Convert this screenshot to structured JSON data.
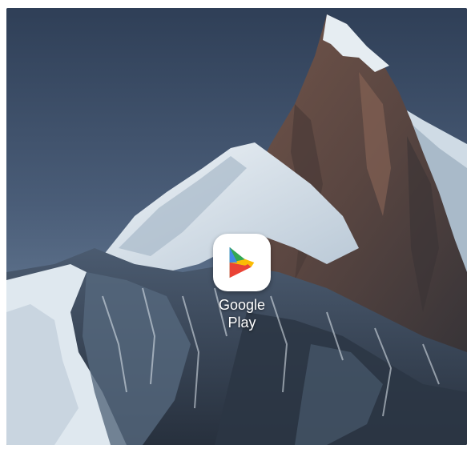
{
  "homescreen": {
    "apps": [
      {
        "icon": "google-play-icon",
        "label_line1": "Google",
        "label_line2": "Play"
      }
    ]
  },
  "colors": {
    "sky_top": "#34465f",
    "sky_bottom": "#7a91a8",
    "rock_dark": "#3b3a3d",
    "rock_warm": "#6e5147",
    "snow": "#dfe8ef",
    "play_green": "#34A853",
    "play_blue": "#4285F4",
    "play_yellow": "#FBBC04",
    "play_red": "#EA4335"
  }
}
